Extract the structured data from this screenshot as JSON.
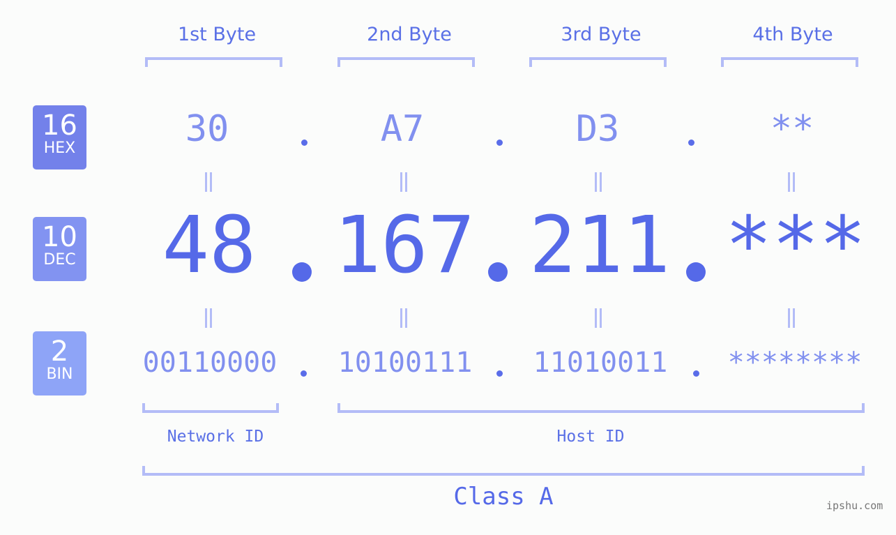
{
  "byte_headers": [
    "1st Byte",
    "2nd Byte",
    "3rd Byte",
    "4th Byte"
  ],
  "badges": {
    "hex": {
      "number": "16",
      "label": "HEX",
      "color": "#7381ea"
    },
    "dec": {
      "number": "10",
      "label": "DEC",
      "color": "#8293f1"
    },
    "bin": {
      "number": "2",
      "label": "BIN",
      "color": "#8ea4f7"
    }
  },
  "hex_values": [
    "30",
    "A7",
    "D3",
    "**"
  ],
  "dec_values": [
    "48",
    "167",
    "211",
    "***"
  ],
  "bin_values": [
    "00110000",
    "10100111",
    "11010011",
    "********"
  ],
  "separator": ".",
  "equals_symbol": "=",
  "network_label": "Network ID",
  "host_label": "Host ID",
  "class_label": "Class A",
  "watermark": "ipshu.com",
  "colors": {
    "accent": "#5569e8",
    "light_accent": "#8190ef",
    "bracket": "#b3bcf7",
    "background": "#fbfcfb"
  }
}
